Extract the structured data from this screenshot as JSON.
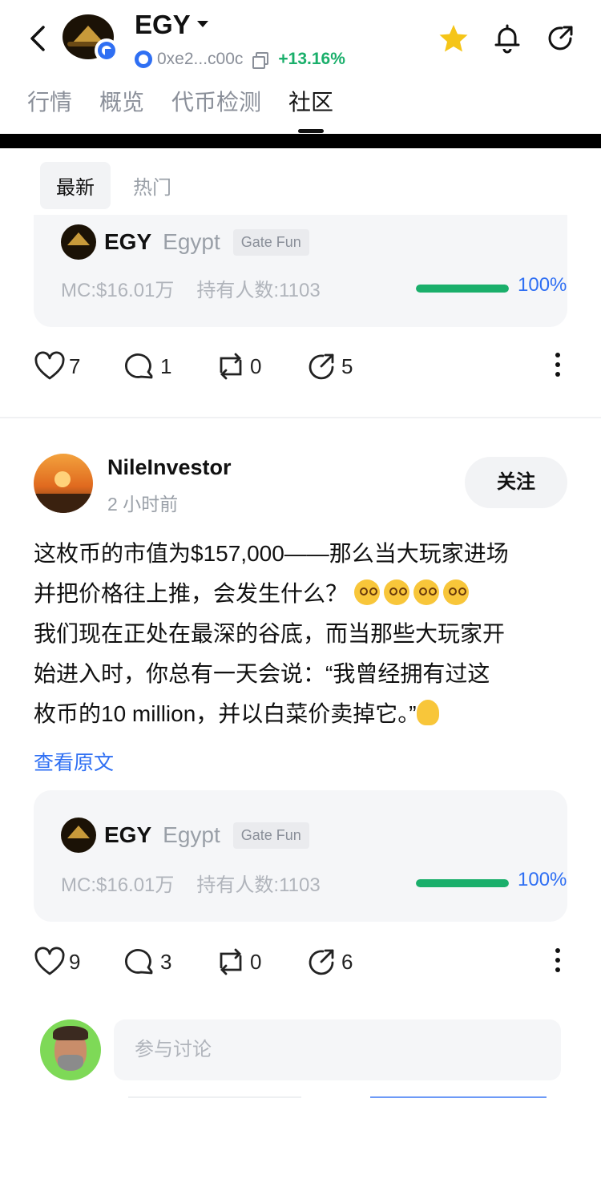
{
  "header": {
    "symbol": "EGY",
    "address": "0xe2...c00c",
    "change": "+13.16%",
    "tabs": [
      {
        "label": "行情"
      },
      {
        "label": "概览"
      },
      {
        "label": "代币检测"
      },
      {
        "label": "社区"
      }
    ],
    "active_tab": "社区",
    "colors": {
      "accent": "#2f6ff3",
      "positive": "#1aaf6b",
      "star": "#f5c518"
    }
  },
  "filters": [
    {
      "label": "最新"
    },
    {
      "label": "热门"
    }
  ],
  "token_card": {
    "symbol": "EGY",
    "name": "Egypt",
    "tag": "Gate Fun",
    "market_cap": "MC:$16.01万",
    "holders": "持有人数:1103",
    "progress_label": "100%",
    "progress_value": 1.0
  },
  "post1_actions": {
    "likes": "7",
    "comments": "1",
    "reposts": "0",
    "shares": "5"
  },
  "post2": {
    "author": "NileInvestor",
    "time": "2 小时前",
    "follow_label": "关注",
    "lines": [
      "这枚币的市值为$157,000——那么当大玩家进场",
      "并把价格往上推，会发生什么？",
      "我们现在正处在最深的谷底，而当那些大玩家开",
      "始进入时，你总有一天会说：“我曾经拥有过这",
      "枚币的10 million，并以白菜价卖掉它。”"
    ],
    "view_original": "查看原文",
    "likes": "9",
    "comments": "3",
    "reposts": "0",
    "shares": "6"
  },
  "comment_input": {
    "placeholder": "参与讨论"
  }
}
